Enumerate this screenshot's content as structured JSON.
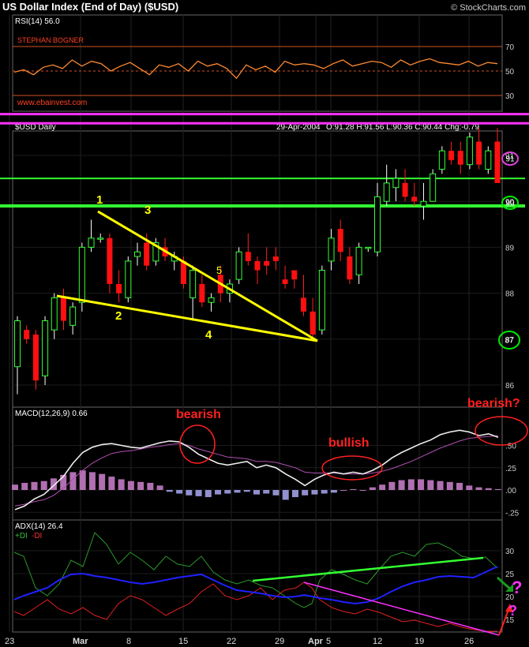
{
  "header": {
    "title": "US Dollar Index (End of Day) ($USD)",
    "copyright": "© StockCharts.com"
  },
  "rsi": {
    "label": "RSI(14) 56.0",
    "author": "STEPHAN BOGNER",
    "website": "www.ebainvest.com",
    "ticks": [
      "70",
      "50",
      "30"
    ],
    "values": [
      49,
      51,
      47,
      53,
      55,
      52,
      59,
      54,
      58,
      56,
      50,
      54,
      57,
      52,
      47,
      55,
      53,
      56,
      50,
      58,
      54,
      56,
      52,
      44,
      55,
      51,
      54,
      49,
      58,
      55,
      56,
      55,
      52,
      56,
      59,
      54,
      56,
      58,
      57,
      53,
      59,
      55,
      58,
      60,
      57,
      56,
      55,
      58,
      54,
      57,
      56
    ]
  },
  "price": {
    "label": "$USD Daily",
    "date": "29-Apr-2004",
    "ohlc": "O:91.28 H:91.56 L:90.36 C:90.44 Chg:-0.79",
    "ticks": [
      "91",
      "90",
      "89",
      "88",
      "87",
      "86"
    ],
    "magenta_lines": [
      91.9,
      91.7
    ],
    "green_lines": [
      90.5,
      89.9
    ],
    "circled_labels": [
      {
        "text": "91",
        "value": 91,
        "color": "#e040e0"
      },
      {
        "text": "90",
        "value": 90,
        "color": "#00ee00"
      },
      {
        "text": "87",
        "value": 87,
        "color": "#00ee00"
      }
    ],
    "wedge_labels": [
      "1",
      "2",
      "3",
      "4",
      "5"
    ]
  },
  "macd": {
    "label": "MACD(12,26,9) 0.66",
    "ticks": [
      ".50",
      ".25",
      ".00",
      "-.25"
    ],
    "annotations": [
      "bearish",
      "bullish",
      "bearish?"
    ],
    "macd_line": [
      -0.22,
      -0.18,
      -0.1,
      -0.05,
      0.05,
      0.15,
      0.3,
      0.42,
      0.48,
      0.51,
      0.52,
      0.5,
      0.48,
      0.47,
      0.5,
      0.53,
      0.55,
      0.54,
      0.48,
      0.4,
      0.35,
      0.3,
      0.28,
      0.3,
      0.32,
      0.25,
      0.28,
      0.25,
      0.18,
      0.12,
      0.05,
      0.12,
      0.17,
      0.2,
      0.18,
      0.2,
      0.18,
      0.22,
      0.28,
      0.36,
      0.42,
      0.47,
      0.52,
      0.56,
      0.62,
      0.65,
      0.67,
      0.65,
      0.61,
      0.63,
      0.59
    ],
    "signal_line": [
      -0.18,
      -0.16,
      -0.13,
      -0.11,
      -0.06,
      0.02,
      0.12,
      0.22,
      0.3,
      0.36,
      0.41,
      0.43,
      0.44,
      0.46,
      0.48,
      0.49,
      0.51,
      0.52,
      0.5,
      0.46,
      0.43,
      0.4,
      0.37,
      0.36,
      0.35,
      0.32,
      0.32,
      0.31,
      0.28,
      0.25,
      0.2,
      0.19,
      0.19,
      0.19,
      0.18,
      0.18,
      0.18,
      0.19,
      0.21,
      0.24,
      0.28,
      0.32,
      0.37,
      0.42,
      0.47,
      0.51,
      0.55,
      0.58,
      0.59,
      0.6,
      0.61
    ],
    "histogram": [
      0.06,
      0.08,
      0.09,
      0.1,
      0.13,
      0.17,
      0.2,
      0.22,
      0.2,
      0.18,
      0.15,
      0.12,
      0.1,
      0.09,
      0.08,
      0.05,
      -0.02,
      -0.04,
      -0.06,
      -0.07,
      -0.08,
      -0.05,
      -0.04,
      -0.03,
      -0.02,
      -0.05,
      -0.04,
      -0.06,
      -0.11,
      -0.08,
      -0.06,
      -0.05,
      -0.04,
      -0.03,
      0.0,
      0.01,
      0.0,
      0.03,
      0.06,
      0.09,
      0.11,
      0.12,
      0.12,
      0.11,
      0.1,
      0.09,
      0.08,
      0.05,
      0.03,
      0.02,
      0.01
    ]
  },
  "adx": {
    "label": "ADX(14) 26.4",
    "plus_di_label": "+DI",
    "minus_di_label": "-DI",
    "ticks": [
      "30",
      "25",
      "20",
      "15"
    ],
    "question_marks": [
      "?",
      "?"
    ]
  },
  "x_axis": {
    "labels": [
      "23",
      "Mar",
      "8",
      "15",
      "22",
      "29",
      "Apr",
      "5",
      "12",
      "19",
      "26"
    ]
  },
  "chart_data": {
    "type": "candlestick",
    "title": "US Dollar Index (End of Day) ($USD)",
    "y_range": [
      85.6,
      92.3
    ],
    "candles": [
      {
        "o": 86.4,
        "h": 87.5,
        "l": 85.8,
        "c": 87.4
      },
      {
        "o": 87.2,
        "h": 87.3,
        "l": 86.9,
        "c": 87.0
      },
      {
        "o": 87.1,
        "h": 87.2,
        "l": 85.9,
        "c": 86.1
      },
      {
        "o": 86.2,
        "h": 87.5,
        "l": 86.0,
        "c": 87.4
      },
      {
        "o": 87.2,
        "h": 88.0,
        "l": 87.0,
        "c": 87.9
      },
      {
        "o": 87.9,
        "h": 88.1,
        "l": 87.2,
        "c": 87.4
      },
      {
        "o": 87.3,
        "h": 87.8,
        "l": 87.1,
        "c": 87.7
      },
      {
        "o": 87.8,
        "h": 89.1,
        "l": 87.6,
        "c": 89.0
      },
      {
        "o": 89.0,
        "h": 89.6,
        "l": 88.9,
        "c": 89.2
      },
      {
        "o": 89.2,
        "h": 89.3,
        "l": 89.1,
        "c": 89.2
      },
      {
        "o": 89.2,
        "h": 89.3,
        "l": 88.0,
        "c": 88.2
      },
      {
        "o": 88.2,
        "h": 88.5,
        "l": 87.8,
        "c": 88.0
      },
      {
        "o": 87.9,
        "h": 88.8,
        "l": 87.8,
        "c": 88.7
      },
      {
        "o": 88.8,
        "h": 89.1,
        "l": 88.6,
        "c": 88.9
      },
      {
        "o": 89.1,
        "h": 89.3,
        "l": 88.5,
        "c": 88.6
      },
      {
        "o": 88.7,
        "h": 89.2,
        "l": 88.6,
        "c": 89.1
      },
      {
        "o": 89.0,
        "h": 89.2,
        "l": 88.7,
        "c": 88.8
      },
      {
        "o": 88.7,
        "h": 88.9,
        "l": 88.5,
        "c": 88.8
      },
      {
        "o": 88.7,
        "h": 88.8,
        "l": 88.1,
        "c": 88.2
      },
      {
        "o": 87.9,
        "h": 88.6,
        "l": 87.4,
        "c": 88.5
      },
      {
        "o": 88.2,
        "h": 88.4,
        "l": 87.7,
        "c": 87.8
      },
      {
        "o": 87.8,
        "h": 88.0,
        "l": 87.6,
        "c": 87.9
      },
      {
        "o": 88.4,
        "h": 88.6,
        "l": 87.8,
        "c": 88.0
      },
      {
        "o": 88.0,
        "h": 88.3,
        "l": 87.8,
        "c": 88.2
      },
      {
        "o": 88.3,
        "h": 89.0,
        "l": 88.2,
        "c": 88.9
      },
      {
        "o": 88.9,
        "h": 89.3,
        "l": 88.6,
        "c": 88.7
      },
      {
        "o": 88.7,
        "h": 88.8,
        "l": 88.2,
        "c": 88.5
      },
      {
        "o": 88.7,
        "h": 89.0,
        "l": 88.4,
        "c": 88.6
      },
      {
        "o": 88.8,
        "h": 89.0,
        "l": 88.5,
        "c": 88.7
      },
      {
        "o": 88.3,
        "h": 88.6,
        "l": 88.1,
        "c": 88.2
      },
      {
        "o": 88.5,
        "h": 88.5,
        "l": 88.1,
        "c": 88.3
      },
      {
        "o": 87.9,
        "h": 88.4,
        "l": 87.5,
        "c": 87.6
      },
      {
        "o": 87.6,
        "h": 87.9,
        "l": 87.0,
        "c": 87.1
      },
      {
        "o": 87.2,
        "h": 88.6,
        "l": 87.1,
        "c": 88.5
      },
      {
        "o": 88.7,
        "h": 89.4,
        "l": 88.5,
        "c": 89.2
      },
      {
        "o": 89.4,
        "h": 89.6,
        "l": 88.7,
        "c": 88.9
      },
      {
        "o": 88.8,
        "h": 89.0,
        "l": 88.2,
        "c": 88.3
      },
      {
        "o": 88.4,
        "h": 89.1,
        "l": 88.2,
        "c": 89.0
      },
      {
        "o": 89.0,
        "h": 89.0,
        "l": 88.9,
        "c": 89.0
      },
      {
        "o": 88.9,
        "h": 90.4,
        "l": 88.8,
        "c": 90.1
      },
      {
        "o": 90.0,
        "h": 90.8,
        "l": 89.9,
        "c": 90.4
      },
      {
        "o": 90.3,
        "h": 90.7,
        "l": 90.0,
        "c": 90.5
      },
      {
        "o": 90.4,
        "h": 90.7,
        "l": 90.0,
        "c": 90.1
      },
      {
        "o": 90.1,
        "h": 90.4,
        "l": 89.9,
        "c": 90.0
      },
      {
        "o": 89.9,
        "h": 90.4,
        "l": 89.6,
        "c": 90.0
      },
      {
        "o": 90.0,
        "h": 90.7,
        "l": 90.0,
        "c": 90.6
      },
      {
        "o": 90.7,
        "h": 91.2,
        "l": 90.6,
        "c": 91.1
      },
      {
        "o": 91.1,
        "h": 91.3,
        "l": 90.8,
        "c": 90.9
      },
      {
        "o": 91.1,
        "h": 91.3,
        "l": 90.6,
        "c": 90.8
      },
      {
        "o": 90.8,
        "h": 91.5,
        "l": 90.7,
        "c": 91.4
      },
      {
        "o": 91.3,
        "h": 91.6,
        "l": 90.7,
        "c": 90.8
      },
      {
        "o": 90.7,
        "h": 91.2,
        "l": 90.6,
        "c": 91.1
      },
      {
        "o": 91.3,
        "h": 91.6,
        "l": 90.4,
        "c": 90.4
      }
    ]
  }
}
